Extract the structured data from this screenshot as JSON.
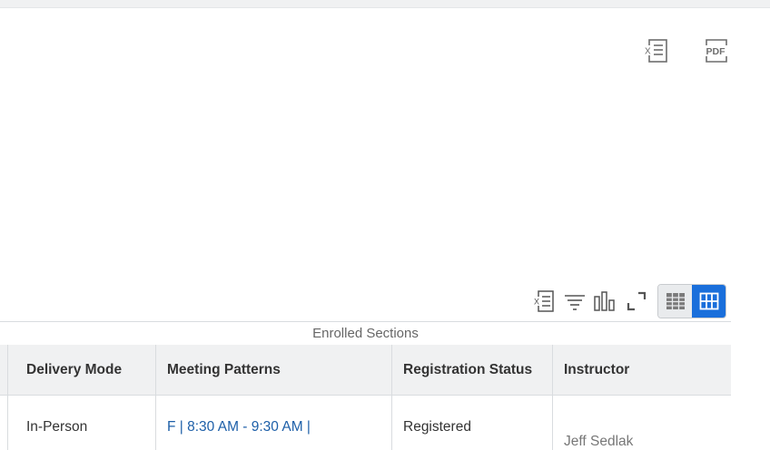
{
  "top_icons": {
    "excel": "excel-export-icon",
    "pdf": "pdf-export-icon",
    "pdf_text": "PDF"
  },
  "toolbar": {
    "icons": [
      "excel-export-icon",
      "filter-icon",
      "chart-icon",
      "fullscreen-icon",
      "table-view-icon",
      "grid-view-icon"
    ],
    "active_view": "grid"
  },
  "grid": {
    "caption": "Enrolled Sections",
    "columns": [
      "Delivery Mode",
      "Meeting Patterns",
      "Registration Status",
      "Instructor"
    ],
    "rows": [
      {
        "delivery_mode": "In-Person",
        "meeting_patterns": "F | 8:30 AM - 9:30 AM |",
        "registration_status": "Registered",
        "instructor": "Jeff Sedlak"
      }
    ]
  },
  "colors": {
    "accent": "#1a6fdb",
    "link": "#1d5fa8",
    "header_bg": "#f0f1f2"
  }
}
